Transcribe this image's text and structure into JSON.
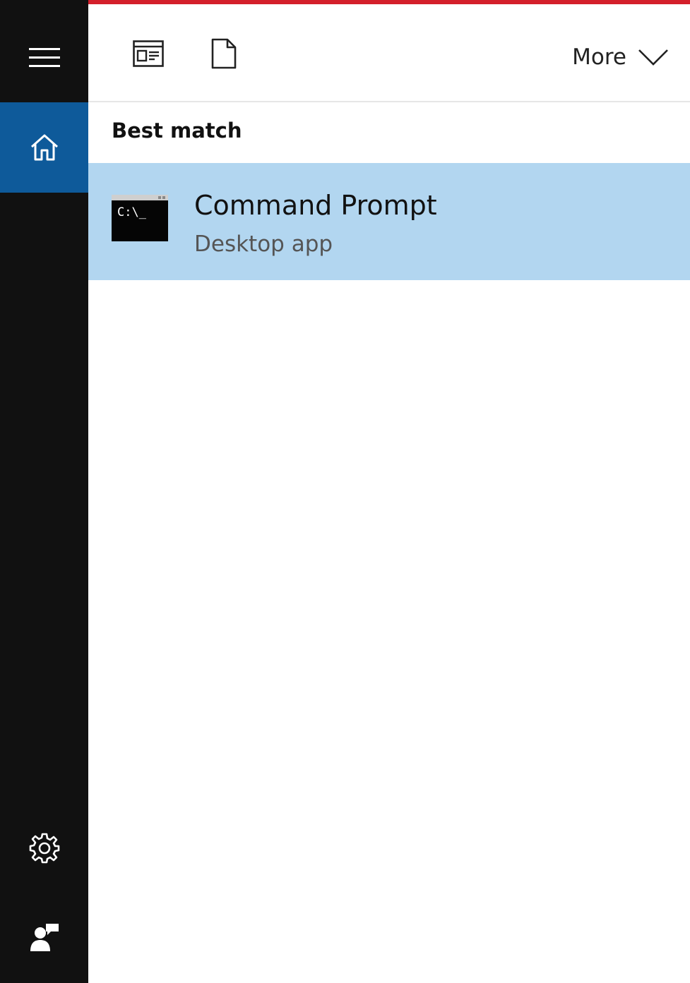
{
  "colors": {
    "accent_strip": "#d41f2b",
    "sidebar_bg": "#111111",
    "sidebar_active": "#0e5a9a",
    "result_highlight": "#b2d6f0"
  },
  "sidebar": {
    "items": [
      {
        "id": "menu",
        "icon": "hamburger-icon"
      },
      {
        "id": "home",
        "icon": "home-icon",
        "active": true
      },
      {
        "id": "settings",
        "icon": "gear-icon"
      },
      {
        "id": "feedback",
        "icon": "feedback-icon"
      }
    ]
  },
  "toolbar": {
    "filters": [
      {
        "id": "apps",
        "icon": "apps-filter-icon"
      },
      {
        "id": "documents",
        "icon": "document-icon"
      }
    ],
    "more_label": "More",
    "more_icon": "chevron-down-icon"
  },
  "results": {
    "section_title": "Best match",
    "best_match": {
      "title": "Command Prompt",
      "subtitle": "Desktop app",
      "icon": "command-prompt-icon",
      "icon_text": "C:\\_"
    }
  }
}
